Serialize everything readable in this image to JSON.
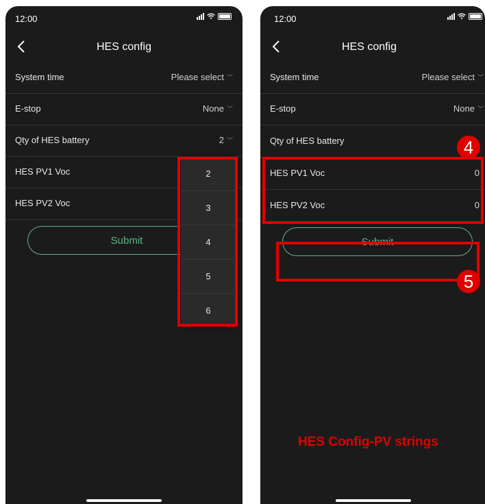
{
  "status_bar": {
    "time": "12:00"
  },
  "nav": {
    "title": "HES config"
  },
  "rows": {
    "system_time": {
      "label": "System time",
      "value": "Please select"
    },
    "e_stop": {
      "label": "E-stop",
      "value": "None"
    },
    "qty_battery": {
      "label": "Qty of HES battery",
      "value": "2"
    },
    "pv1": {
      "label": "HES PV1 Voc",
      "value": "0"
    },
    "pv2": {
      "label": "HES PV2 Voc",
      "value": "0"
    }
  },
  "dropdown": {
    "options": [
      "2",
      "3",
      "4",
      "5",
      "6"
    ]
  },
  "submit_label": "Submit",
  "badges": {
    "step4": "4",
    "step5": "5"
  },
  "caption": "HES Config-PV strings",
  "colors": {
    "highlight": "#e00000",
    "accent": "#5fb58a",
    "background": "#1b1b1b"
  }
}
